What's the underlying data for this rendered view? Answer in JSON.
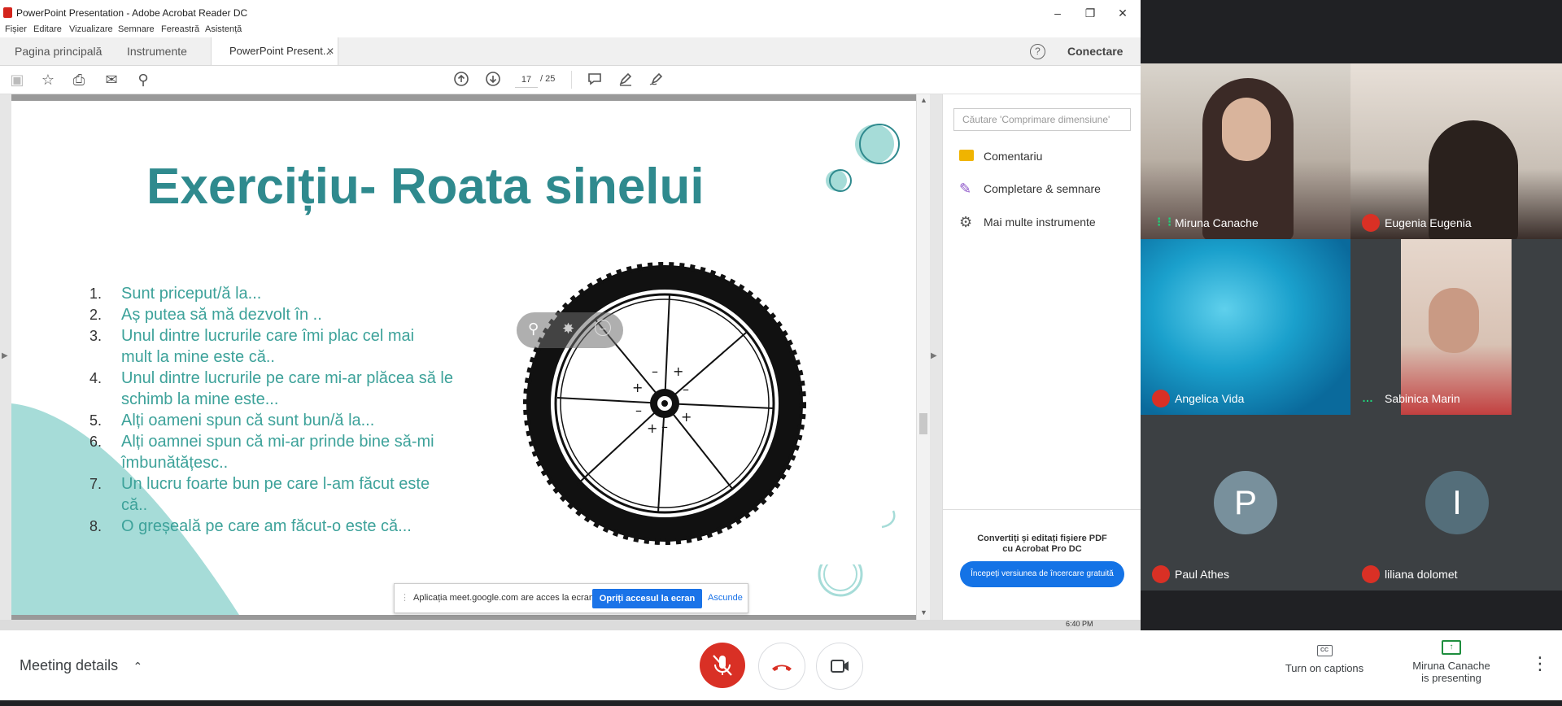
{
  "acrobat": {
    "window_title": "PowerPoint Presentation - Adobe Acrobat Reader DC",
    "menu": [
      "Fișier",
      "Editare",
      "Vizualizare",
      "Semnare",
      "Fereastră",
      "Asistență"
    ],
    "tabs": {
      "home": "Pagina principală",
      "tools": "Instrumente",
      "document": "PowerPoint Present..."
    },
    "help_symbol": "?",
    "sign_in": "Conectare",
    "page": {
      "current": "17",
      "total": "/ 25"
    },
    "tool_pane": {
      "search_placeholder": "Căutare 'Comprimare dimensiune'",
      "items": [
        "Comentariu",
        "Completare & semnare",
        "Mai multe instrumente"
      ],
      "promo_line1": "Convertiți și editați fișiere PDF",
      "promo_line2": "cu Acrobat Pro DC",
      "trial_button": "Începeți versiunea de încercare gratuită"
    }
  },
  "slide": {
    "title": "Exercițiu- Roata sinelui",
    "items": [
      {
        "num": "1.",
        "text": "Sunt priceput/ă la..."
      },
      {
        "num": "2.",
        "text": "Aș putea să mă dezvolt în .."
      },
      {
        "num": "3.",
        "text": "Unul dintre lucrurile care îmi plac cel mai mult la mine este că.."
      },
      {
        "num": "4.",
        "text": "Unul dintre lucrurile pe care mi-ar plăcea să le schimb la mine este..."
      },
      {
        "num": "5.",
        "text": "Alți oameni spun că sunt bun/ă la..."
      },
      {
        "num": "6.",
        "text": "Alți oamnei spun că mi-ar prinde bine să-mi îmbunătățesc.."
      },
      {
        "num": "7.",
        "text": "Un lucru foarte bun pe care l-am făcut este că.."
      },
      {
        "num": "8.",
        "text": "O greșeală pe care am făcut-o este că..."
      }
    ]
  },
  "share_banner": {
    "text": "Aplicația meet.google.com are acces la ecran.",
    "stop_button": "Opriți accesul la ecran",
    "hide_link": "Ascunde"
  },
  "taskbar_time": "6:40 PM",
  "meet": {
    "participants": [
      {
        "name": "Miruna Canache",
        "status": "speaking"
      },
      {
        "name": "Eugenia Eugenia",
        "status": "muted"
      },
      {
        "name": "Angelica Vida",
        "status": "muted"
      },
      {
        "name": "Sabinica Marin",
        "status": "more"
      },
      {
        "name": "Paul Athes",
        "status": "muted",
        "initial": "P"
      },
      {
        "name": "liliana dolomet",
        "status": "muted",
        "initial": "I"
      }
    ],
    "meeting_details": "Meeting details",
    "captions": "Turn on captions",
    "presenting_line1": "Miruna Canache",
    "presenting_line2": "is presenting"
  },
  "colors": {
    "title_teal": "#2f8a8e",
    "list_teal": "#3da29a",
    "mic_red": "#d93025",
    "acrobat_blue": "#1473e6"
  }
}
